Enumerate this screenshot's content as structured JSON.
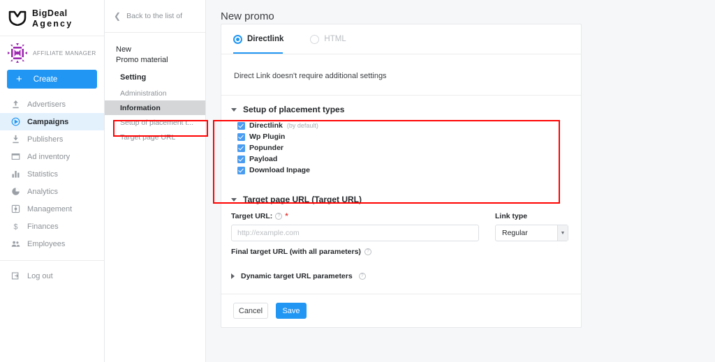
{
  "brand": {
    "logo_icon": "bigdeal-shield-logo",
    "line1": "BigDeal",
    "line2": "Agency"
  },
  "sidebar": {
    "affiliate_icon": "affiliate-manager-snowflake-icon",
    "affiliate_label": "AFFILIATE MANAGER",
    "create_label": "Create",
    "create_icon": "plus-icon",
    "accent_color": "#2196f3",
    "active_bg_color": "#e3f1fd",
    "items": [
      {
        "label": "Advertisers",
        "icon": "upload-arrow-icon",
        "active": false
      },
      {
        "label": "Campaigns",
        "icon": "play-circle-icon",
        "active": true
      },
      {
        "label": "Publishers",
        "icon": "download-arrow-icon",
        "active": false
      },
      {
        "label": "Ad inventory",
        "icon": "window-card-icon",
        "active": false
      },
      {
        "label": "Statistics",
        "icon": "bar-chart-icon",
        "active": false
      },
      {
        "label": "Analytics",
        "icon": "pie-chart-icon",
        "active": false
      },
      {
        "label": "Management",
        "icon": "settings-box-icon",
        "active": false
      },
      {
        "label": "Finances",
        "icon": "dollar-sign-icon",
        "active": false
      },
      {
        "label": "Employees",
        "icon": "people-icon",
        "active": false
      }
    ],
    "logout_label": "Log out",
    "logout_icon": "logout-arrow-icon"
  },
  "panel2": {
    "back_label": "Back to the list of",
    "back_icon": "chevron-left-icon",
    "tree_title_line1": "New",
    "tree_title_line2": "Promo material",
    "group_label": "Setting",
    "items": [
      {
        "label": "Administration",
        "selected": false
      },
      {
        "label": "Information",
        "selected": true
      },
      {
        "label": "Setup of placement t...",
        "selected": false
      },
      {
        "label": "Target page URL",
        "selected": false
      }
    ]
  },
  "main": {
    "page_title": "New promo",
    "tabs": [
      {
        "label": "Directlink",
        "active": true
      },
      {
        "label": "HTML",
        "active": false
      }
    ],
    "tab_body_text": "Direct Link doesn't require additional settings",
    "placement_section": {
      "title": "Setup of placement types",
      "caret": "caret-down-icon",
      "options": [
        {
          "label": "Directlink",
          "note": "(by default)",
          "checked": true
        },
        {
          "label": "Wp Plugin",
          "note": "",
          "checked": true
        },
        {
          "label": "Popunder",
          "note": "",
          "checked": true
        },
        {
          "label": "Payload",
          "note": "",
          "checked": true
        },
        {
          "label": "Download Inpage",
          "note": "",
          "checked": true
        }
      ]
    },
    "target_section": {
      "title": "Target page URL (Target URL)",
      "caret": "caret-down-icon",
      "target_url_label": "Target URL:",
      "target_url_help_icon": "help-circle-icon",
      "target_url_required_mark": "*",
      "target_url_value": "",
      "target_url_placeholder": "http://example.com",
      "link_type_label": "Link type",
      "link_type_value": "Regular",
      "link_type_caret": "chevron-down-icon",
      "final_url_label": "Final target URL (with all parameters)",
      "final_url_help_icon": "help-circle-icon",
      "dynamic_label": "Dynamic target URL parameters",
      "dynamic_caret": "caret-right-icon",
      "dynamic_help_icon": "help-circle-icon"
    },
    "footer": {
      "cancel_label": "Cancel",
      "save_label": "Save"
    }
  },
  "annotations": {
    "color": "#ff0000",
    "boxes": [
      {
        "name": "tree-setup-of-placement-highlight"
      },
      {
        "name": "setup-of-placement-types-section-highlight"
      }
    ]
  }
}
